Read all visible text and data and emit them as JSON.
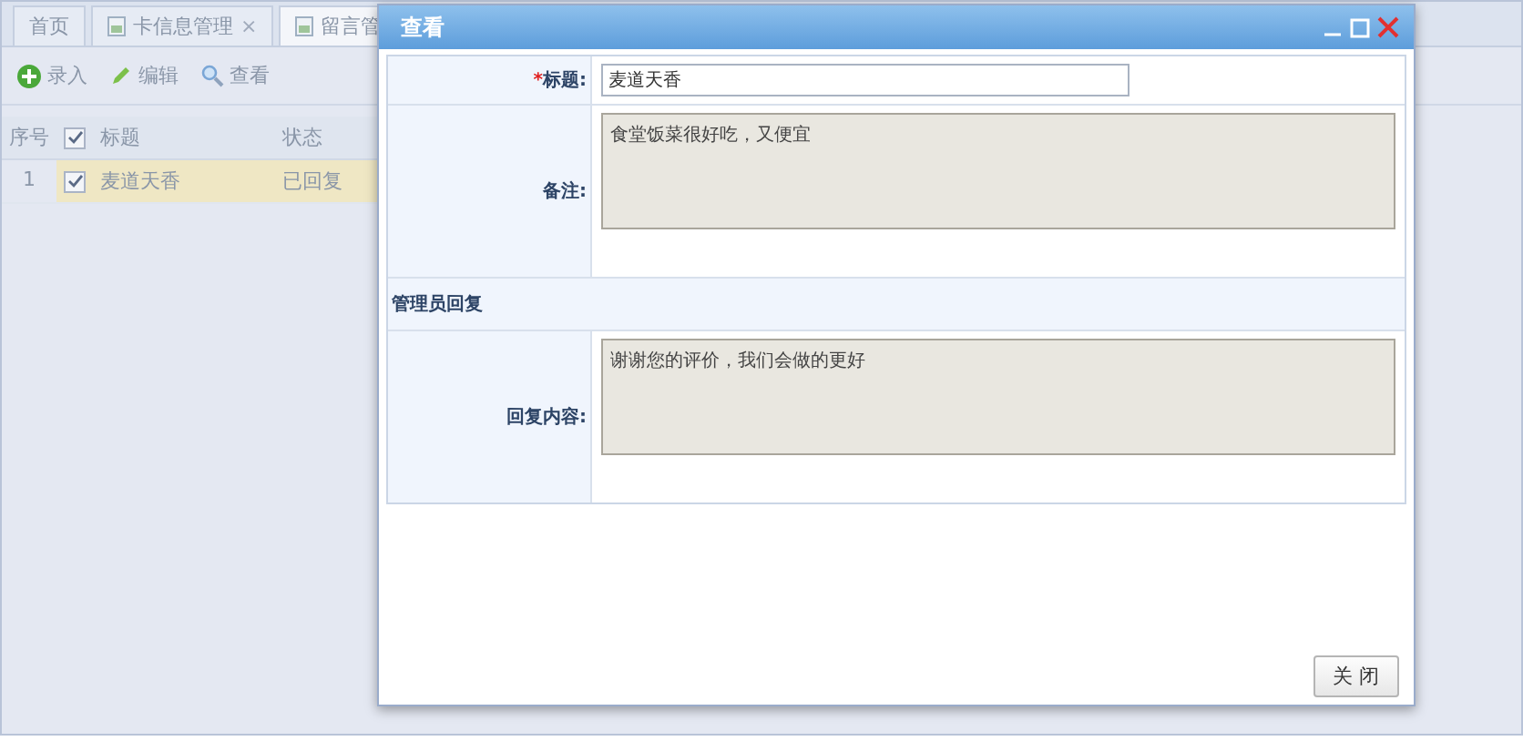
{
  "tabs": [
    {
      "label": "首页",
      "closable": false,
      "selected": false
    },
    {
      "label": "卡信息管理",
      "closable": true,
      "selected": false
    },
    {
      "label": "留言管",
      "closable": false,
      "selected": true
    }
  ],
  "close_mark": "×",
  "toolbar": [
    {
      "kind": "add",
      "label": "录入"
    },
    {
      "kind": "edit",
      "label": "编辑"
    },
    {
      "kind": "search",
      "label": "查看"
    }
  ],
  "table": {
    "columns": [
      "序号",
      "标题",
      "状态"
    ],
    "header_checked": true,
    "rows": [
      {
        "cells": [
          "1",
          "麦道天香",
          "已回复"
        ],
        "checked": true,
        "selected": true
      }
    ]
  },
  "dialog": {
    "title": "查看",
    "fields": [
      {
        "kind": "input",
        "label": "标题:",
        "required": true,
        "required_mark": "*",
        "value": "麦道天香"
      },
      {
        "kind": "textarea",
        "label": "备注:",
        "value": "食堂饭菜很好吃，又便宜"
      },
      {
        "kind": "section",
        "label": "管理员回复"
      },
      {
        "kind": "textarea",
        "label": "回复内容:",
        "value": "谢谢您的评价，我们会做的更好"
      }
    ],
    "button": "关 闭"
  }
}
